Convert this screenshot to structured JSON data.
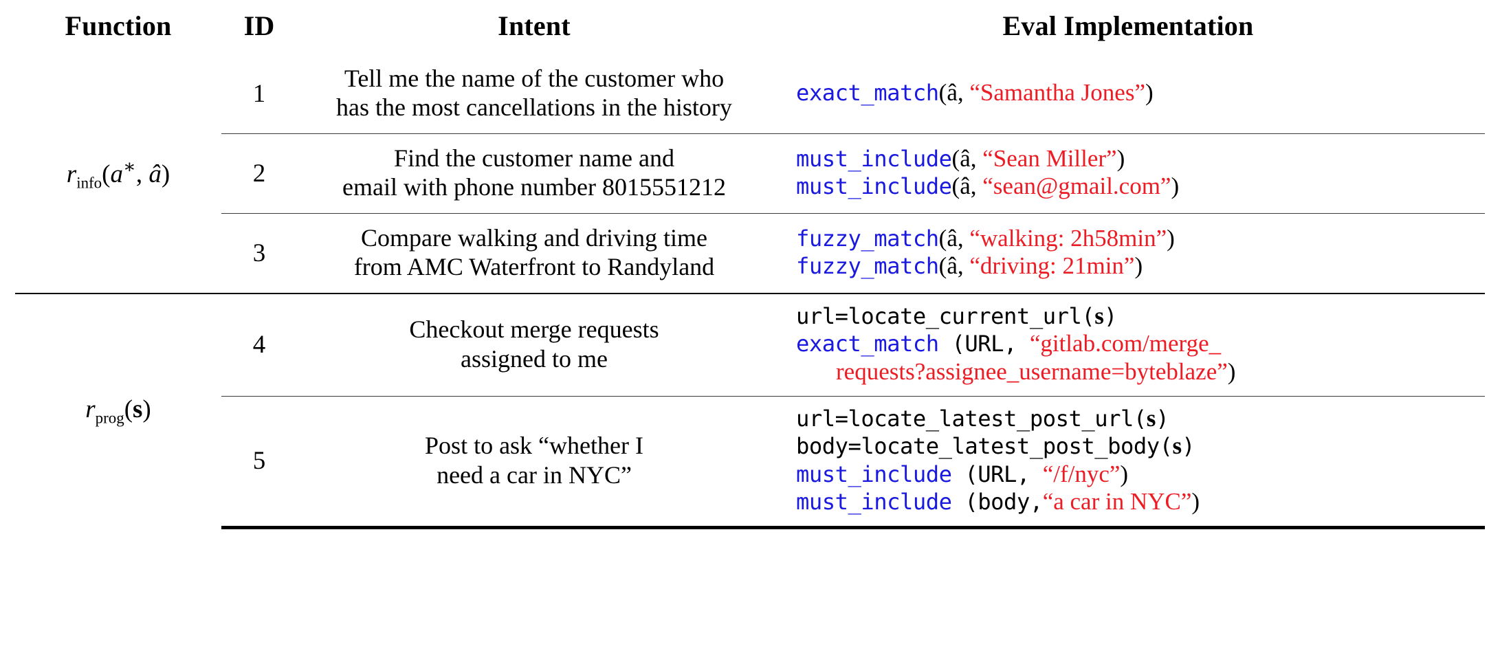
{
  "table": {
    "headers": {
      "function": "Function",
      "id": "ID",
      "intent": "Intent",
      "eval": "Eval Implementation"
    },
    "groups": [
      {
        "function_label": "r_info(a*, â)",
        "function_base": "r",
        "function_sub": "info",
        "function_args": "(a*, â)",
        "rows": [
          {
            "id": "1",
            "intent_lines": [
              "Tell me the name of the customer who",
              "has the most cancellations in the history"
            ],
            "eval_lines": [
              {
                "indent": false,
                "parts": [
                  {
                    "text": "exact_match",
                    "style": "fn-blue",
                    "mono": true
                  },
                  {
                    "text": "(â, ",
                    "style": "fn-black",
                    "mono": false
                  },
                  {
                    "text": "“Samantha Jones”",
                    "style": "str-red",
                    "mono": false
                  },
                  {
                    "text": ")",
                    "style": "fn-black",
                    "mono": false
                  }
                ]
              }
            ]
          },
          {
            "id": "2",
            "intent_lines": [
              "Find the customer name and",
              "email with phone number 8015551212"
            ],
            "eval_lines": [
              {
                "indent": false,
                "parts": [
                  {
                    "text": "must_include",
                    "style": "fn-blue",
                    "mono": true
                  },
                  {
                    "text": "(â, ",
                    "style": "fn-black",
                    "mono": false
                  },
                  {
                    "text": "“Sean Miller”",
                    "style": "str-red",
                    "mono": false
                  },
                  {
                    "text": ")",
                    "style": "fn-black",
                    "mono": false
                  }
                ]
              },
              {
                "indent": false,
                "parts": [
                  {
                    "text": "must_include",
                    "style": "fn-blue",
                    "mono": true
                  },
                  {
                    "text": "(â, ",
                    "style": "fn-black",
                    "mono": false
                  },
                  {
                    "text": "“sean@gmail.com”",
                    "style": "str-red",
                    "mono": false
                  },
                  {
                    "text": ")",
                    "style": "fn-black",
                    "mono": false
                  }
                ]
              }
            ]
          },
          {
            "id": "3",
            "intent_lines": [
              "Compare walking and driving time",
              "from AMC Waterfront to Randyland"
            ],
            "eval_lines": [
              {
                "indent": false,
                "parts": [
                  {
                    "text": "fuzzy_match",
                    "style": "fn-blue",
                    "mono": true
                  },
                  {
                    "text": "(â, ",
                    "style": "fn-black",
                    "mono": false
                  },
                  {
                    "text": "“walking: 2h58min”",
                    "style": "str-red",
                    "mono": false
                  },
                  {
                    "text": ")",
                    "style": "fn-black",
                    "mono": false
                  }
                ]
              },
              {
                "indent": false,
                "parts": [
                  {
                    "text": "fuzzy_match",
                    "style": "fn-blue",
                    "mono": true
                  },
                  {
                    "text": "(â, ",
                    "style": "fn-black",
                    "mono": false
                  },
                  {
                    "text": "“driving: 21min”",
                    "style": "str-red",
                    "mono": false
                  },
                  {
                    "text": ")",
                    "style": "fn-black",
                    "mono": false
                  }
                ]
              }
            ]
          }
        ]
      },
      {
        "function_label": "r_prog(s)",
        "function_base": "r",
        "function_sub": "prog",
        "function_args": "(s)",
        "rows": [
          {
            "id": "4",
            "intent_lines": [
              "Checkout merge requests",
              "assigned to me"
            ],
            "eval_lines": [
              {
                "indent": false,
                "parts": [
                  {
                    "text": "url=locate_current_url",
                    "style": "fn-black",
                    "mono": true
                  },
                  {
                    "text": "(",
                    "style": "fn-black",
                    "mono": true
                  },
                  {
                    "text": "s",
                    "style": "bold-s",
                    "mono": false
                  },
                  {
                    "text": ")",
                    "style": "fn-black",
                    "mono": true
                  }
                ]
              },
              {
                "indent": false,
                "parts": [
                  {
                    "text": "exact_match",
                    "style": "fn-blue",
                    "mono": true
                  },
                  {
                    "text": " (URL, ",
                    "style": "fn-black",
                    "mono": true
                  },
                  {
                    "text": "“gitlab.com/merge_",
                    "style": "str-red",
                    "mono": false
                  }
                ]
              },
              {
                "indent": true,
                "parts": [
                  {
                    "text": "requests?assignee_username=byteblaze”",
                    "style": "str-red",
                    "mono": false
                  },
                  {
                    "text": ")",
                    "style": "fn-black",
                    "mono": false
                  }
                ]
              }
            ]
          },
          {
            "id": "5",
            "intent_lines": [
              "Post to ask “whether I",
              "need a car in NYC”"
            ],
            "eval_lines": [
              {
                "indent": false,
                "parts": [
                  {
                    "text": "url=locate_latest_post_url",
                    "style": "fn-black",
                    "mono": true
                  },
                  {
                    "text": "(",
                    "style": "fn-black",
                    "mono": true
                  },
                  {
                    "text": "s",
                    "style": "bold-s",
                    "mono": false
                  },
                  {
                    "text": ")",
                    "style": "fn-black",
                    "mono": true
                  }
                ]
              },
              {
                "indent": false,
                "parts": [
                  {
                    "text": "body=locate_latest_post_body",
                    "style": "fn-black",
                    "mono": true
                  },
                  {
                    "text": "(",
                    "style": "fn-black",
                    "mono": true
                  },
                  {
                    "text": "s",
                    "style": "bold-s",
                    "mono": false
                  },
                  {
                    "text": ")",
                    "style": "fn-black",
                    "mono": true
                  }
                ]
              },
              {
                "indent": false,
                "parts": [
                  {
                    "text": "must_include",
                    "style": "fn-blue",
                    "mono": true
                  },
                  {
                    "text": " (URL, ",
                    "style": "fn-black",
                    "mono": true
                  },
                  {
                    "text": "“/f/nyc”",
                    "style": "str-red",
                    "mono": false
                  },
                  {
                    "text": ")",
                    "style": "fn-black",
                    "mono": false
                  }
                ]
              },
              {
                "indent": false,
                "parts": [
                  {
                    "text": "must_include",
                    "style": "fn-blue",
                    "mono": true
                  },
                  {
                    "text": " (body,",
                    "style": "fn-black",
                    "mono": true
                  },
                  {
                    "text": "“a car in NYC”",
                    "style": "str-red",
                    "mono": false
                  },
                  {
                    "text": ")",
                    "style": "fn-black",
                    "mono": false
                  }
                ]
              }
            ]
          }
        ]
      }
    ],
    "colors": {
      "function_name": "#1a19e0",
      "string_literal": "#ec1c24",
      "text": "#000000",
      "rule": "#000000"
    }
  }
}
